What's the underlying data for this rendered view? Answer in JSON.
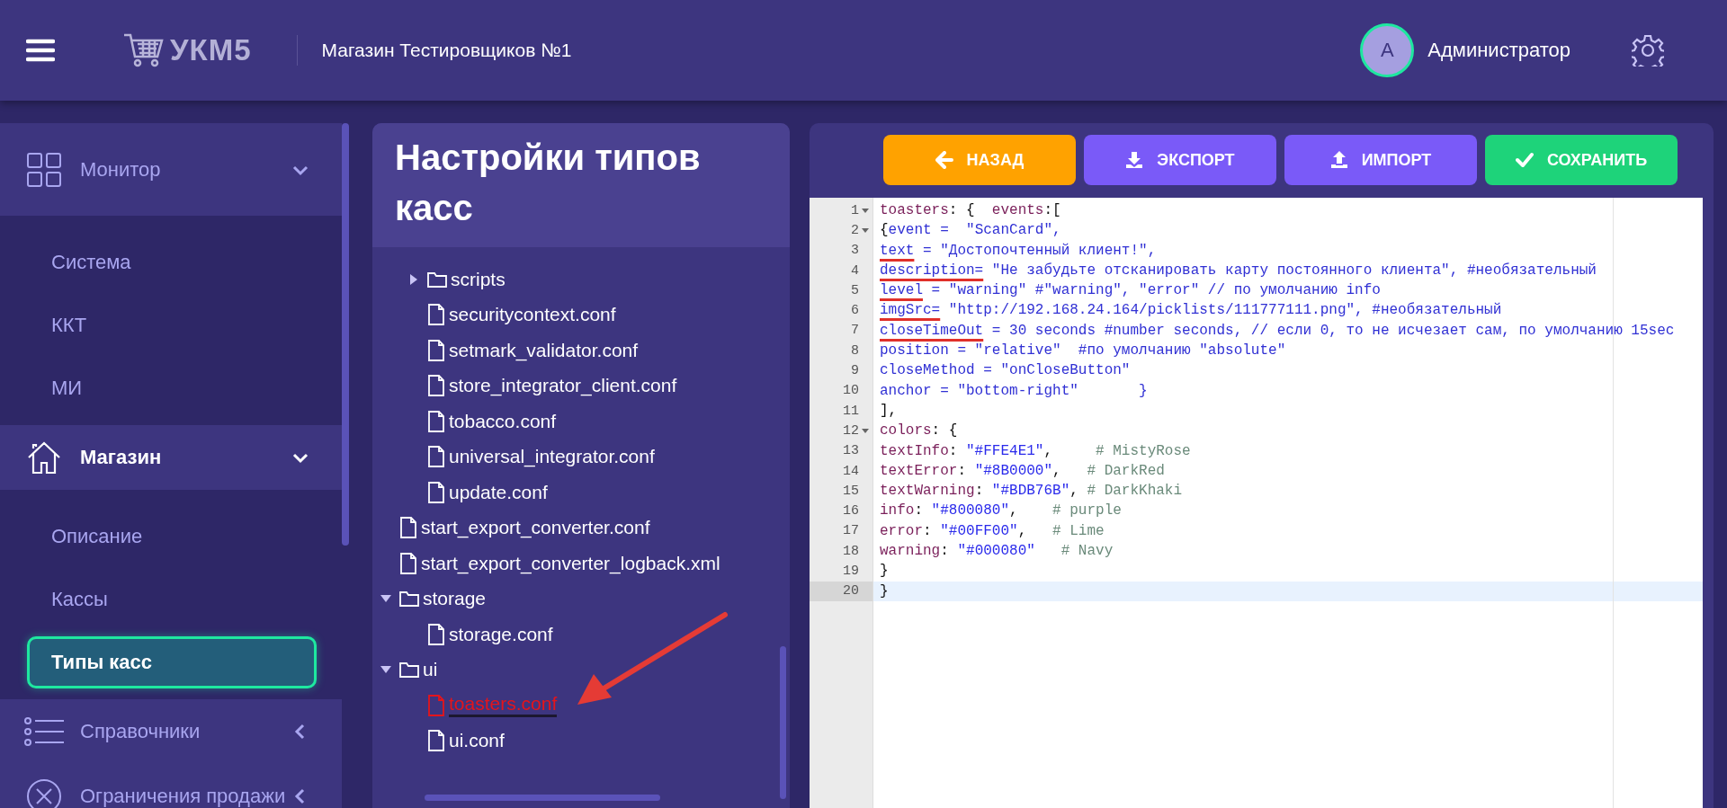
{
  "header": {
    "store_name": "Магазин Тестировщиков №1",
    "logo_text": "УКМ5",
    "avatar_letter": "А",
    "user_name": "Администратор"
  },
  "sidebar": {
    "sections": [
      {
        "label": "Монитор",
        "expanded": true,
        "current": false,
        "children": [
          {
            "label": "Система",
            "selected": false
          },
          {
            "label": "ККТ",
            "selected": false
          },
          {
            "label": "МИ",
            "selected": false
          }
        ]
      },
      {
        "label": "Магазин",
        "expanded": true,
        "current": true,
        "children": [
          {
            "label": "Описание",
            "selected": false
          },
          {
            "label": "Кассы",
            "selected": false
          },
          {
            "label": "Типы касс",
            "selected": true
          }
        ]
      },
      {
        "label": "Справочники",
        "expanded": false,
        "current": false
      },
      {
        "label": "Ограничения продажи",
        "expanded": false,
        "current": false
      }
    ]
  },
  "tree_panel": {
    "title": "Настройки типов касс",
    "scrolled_parent_children": [
      {
        "kind": "folder",
        "label": "scripts",
        "expanded": false,
        "selected": false
      },
      {
        "kind": "file",
        "label": "securitycontext.conf",
        "selected": false
      },
      {
        "kind": "file",
        "label": "setmark_validator.conf",
        "selected": false
      },
      {
        "kind": "file",
        "label": "store_integrator_client.conf",
        "selected": false
      },
      {
        "kind": "file",
        "label": "tobacco.conf",
        "selected": false
      },
      {
        "kind": "file",
        "label": "universal_integrator.conf",
        "selected": false
      },
      {
        "kind": "file",
        "label": "update.conf",
        "selected": false
      }
    ],
    "items": [
      {
        "kind": "file",
        "label": "start_export_converter.conf",
        "selected": false
      },
      {
        "kind": "file",
        "label": "start_export_converter_logback.xml",
        "selected": false
      },
      {
        "kind": "folder",
        "label": "storage",
        "expanded": true,
        "selected": false,
        "children": [
          {
            "kind": "file",
            "label": "storage.conf",
            "selected": false
          }
        ]
      },
      {
        "kind": "folder",
        "label": "ui",
        "expanded": true,
        "selected": false,
        "children": [
          {
            "kind": "file",
            "label": "toasters.conf",
            "selected": true
          },
          {
            "kind": "file",
            "label": "ui.conf",
            "selected": false
          }
        ]
      }
    ]
  },
  "editor": {
    "buttons": [
      {
        "label": "НАЗАД",
        "kind": "back"
      },
      {
        "label": "ЭКСПОРТ",
        "kind": "export"
      },
      {
        "label": "ИМПОРТ",
        "kind": "import"
      },
      {
        "label": "СОХРАНИТЬ",
        "kind": "save"
      }
    ],
    "lines": [
      {
        "number": "1",
        "fold": true,
        "active": false,
        "segments": [
          {
            "kind": "ident",
            "text": "toasters"
          },
          {
            "kind": "punct",
            "text": ": {  "
          },
          {
            "kind": "ident",
            "text": "events"
          },
          {
            "kind": "punct",
            "text": ":["
          }
        ]
      },
      {
        "number": "2",
        "fold": true,
        "active": false,
        "segments": [
          {
            "kind": "punct",
            "text": "{"
          },
          {
            "kind": "text",
            "text": "event =  \"ScanCard\","
          }
        ]
      },
      {
        "number": "3",
        "fold": false,
        "active": false,
        "segments": [
          {
            "kind": "text",
            "text": "text",
            "underlined": true
          },
          {
            "kind": "text",
            "text": " = \"Достопочтенный клиент!\","
          }
        ]
      },
      {
        "number": "4",
        "fold": false,
        "active": false,
        "segments": [
          {
            "kind": "text",
            "text": "description=",
            "underlined": true
          },
          {
            "kind": "text",
            "text": " \"Не забудьте отсканировать карту постоянного клиента\", #необязательный"
          }
        ]
      },
      {
        "number": "5",
        "fold": false,
        "active": false,
        "segments": [
          {
            "kind": "text",
            "text": "level",
            "underlined": true
          },
          {
            "kind": "text",
            "text": " = \"warning\" #\"warning\", \"error\" // по умолчанию info"
          }
        ]
      },
      {
        "number": "6",
        "fold": false,
        "active": false,
        "segments": [
          {
            "kind": "text",
            "text": "imgSrc=",
            "underlined": true
          },
          {
            "kind": "text",
            "text": " \"http://192.168.24.164/picklists/111777111.png\", #необязательный"
          }
        ]
      },
      {
        "number": "7",
        "fold": false,
        "active": false,
        "segments": [
          {
            "kind": "text",
            "text": "closeTimeOut",
            "underlined": true
          },
          {
            "kind": "text",
            "text": " = 30 seconds #number seconds, // если 0, то не исчезает сам, по умолчанию 15sec"
          }
        ]
      },
      {
        "number": "8",
        "fold": false,
        "active": false,
        "segments": [
          {
            "kind": "text",
            "text": "position = \"relative\"  #по умолчанию \"absolute\""
          }
        ]
      },
      {
        "number": "9",
        "fold": false,
        "active": false,
        "segments": [
          {
            "kind": "text",
            "text": "closeMethod = \"onCloseButton\""
          }
        ]
      },
      {
        "number": "10",
        "fold": false,
        "active": false,
        "segments": [
          {
            "kind": "text",
            "text": "anchor = \"bottom-right\"       }"
          }
        ]
      },
      {
        "number": "11",
        "fold": false,
        "active": false,
        "segments": [
          {
            "kind": "punct",
            "text": "],"
          }
        ]
      },
      {
        "number": "12",
        "fold": true,
        "active": false,
        "segments": [
          {
            "kind": "ident",
            "text": "colors"
          },
          {
            "kind": "punct",
            "text": ": {"
          }
        ]
      },
      {
        "number": "13",
        "fold": false,
        "active": false,
        "segments": [
          {
            "kind": "ident",
            "text": "textInfo"
          },
          {
            "kind": "punct",
            "text": ": "
          },
          {
            "kind": "string",
            "text": "\"#FFE4E1\""
          },
          {
            "kind": "punct",
            "text": ",     "
          },
          {
            "kind": "comment",
            "text": "# MistyRose"
          }
        ]
      },
      {
        "number": "14",
        "fold": false,
        "active": false,
        "segments": [
          {
            "kind": "ident",
            "text": "textError"
          },
          {
            "kind": "punct",
            "text": ": "
          },
          {
            "kind": "string",
            "text": "\"#8B0000\""
          },
          {
            "kind": "punct",
            "text": ",   "
          },
          {
            "kind": "comment",
            "text": "# DarkRed"
          }
        ]
      },
      {
        "number": "15",
        "fold": false,
        "active": false,
        "segments": [
          {
            "kind": "ident",
            "text": "textWarning"
          },
          {
            "kind": "punct",
            "text": ": "
          },
          {
            "kind": "string",
            "text": "\"#BDB76B\""
          },
          {
            "kind": "punct",
            "text": ", "
          },
          {
            "kind": "comment",
            "text": "# DarkKhaki"
          }
        ]
      },
      {
        "number": "16",
        "fold": false,
        "active": false,
        "segments": [
          {
            "kind": "ident",
            "text": "info"
          },
          {
            "kind": "punct",
            "text": ": "
          },
          {
            "kind": "string",
            "text": "\"#800080\""
          },
          {
            "kind": "punct",
            "text": ",    "
          },
          {
            "kind": "comment",
            "text": "# purple"
          }
        ]
      },
      {
        "number": "17",
        "fold": false,
        "active": false,
        "segments": [
          {
            "kind": "ident",
            "text": "error"
          },
          {
            "kind": "punct",
            "text": ": "
          },
          {
            "kind": "string",
            "text": "\"#00FF00\""
          },
          {
            "kind": "punct",
            "text": ",   "
          },
          {
            "kind": "comment",
            "text": "# Lime"
          }
        ]
      },
      {
        "number": "18",
        "fold": false,
        "active": false,
        "segments": [
          {
            "kind": "ident",
            "text": "warning"
          },
          {
            "kind": "punct",
            "text": ": "
          },
          {
            "kind": "string",
            "text": "\"#000080\""
          },
          {
            "kind": "comment",
            "text": "   # Navy"
          }
        ]
      },
      {
        "number": "19",
        "fold": false,
        "active": false,
        "segments": [
          {
            "kind": "punct",
            "text": "}"
          }
        ]
      },
      {
        "number": "20",
        "fold": false,
        "active": true,
        "segments": [
          {
            "kind": "punct",
            "text": "}"
          }
        ]
      }
    ]
  }
}
